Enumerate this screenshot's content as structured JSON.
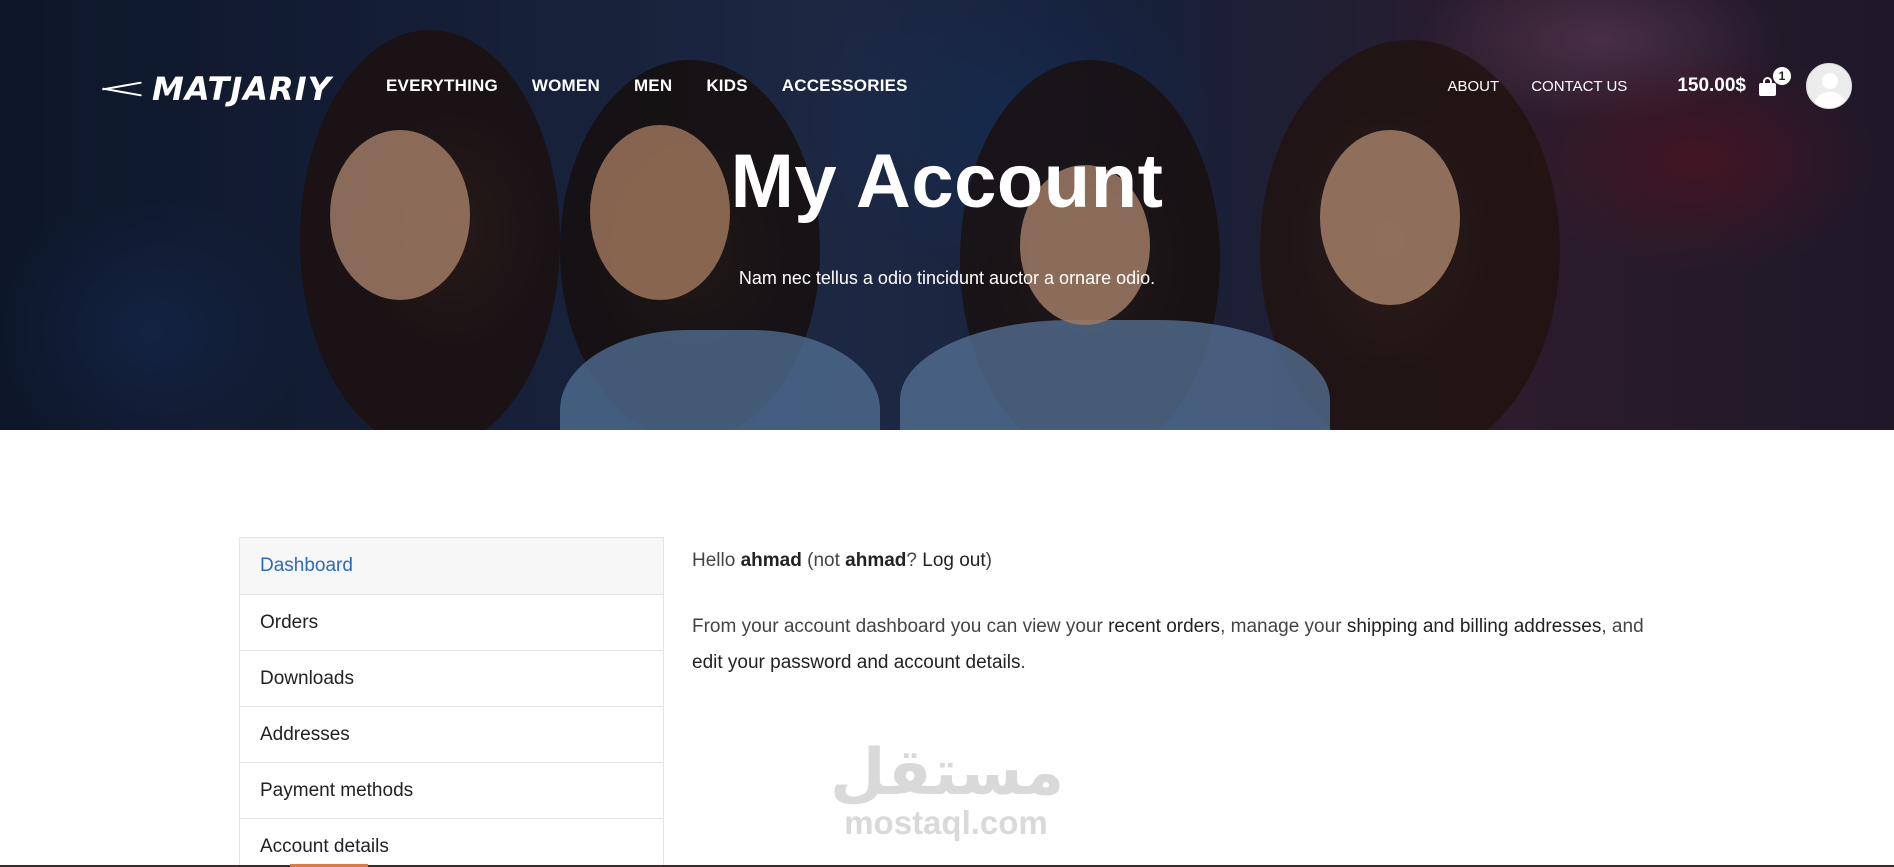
{
  "header": {
    "logo_text": "MATJARIY",
    "nav": [
      "EVERYTHING",
      "WOMEN",
      "MEN",
      "KIDS",
      "ACCESSORIES"
    ],
    "right_links": [
      "ABOUT",
      "CONTACT US"
    ],
    "cart_total": "150.00$",
    "cart_count": "1"
  },
  "hero": {
    "title": "My Account",
    "subtitle": "Nam nec tellus a odio tincidunt auctor a ornare odio."
  },
  "account_nav": {
    "items": [
      "Dashboard",
      "Orders",
      "Downloads",
      "Addresses",
      "Payment methods",
      "Account details"
    ],
    "active": "Dashboard"
  },
  "content": {
    "hello": "Hello",
    "username": "ahmad",
    "not_text": "(not",
    "username_2": "ahmad",
    "question": "?",
    "logout": "Log out",
    "close_paren": ")",
    "intro": "From your account dashboard you can view your",
    "recent_orders": "recent orders",
    "manage": ", manage your",
    "addresses": "shipping and billing addresses",
    "and": ", and",
    "edit": "edit your password and account details",
    "end": "."
  },
  "watermark": {
    "arabic": "مستقل",
    "latin": "mostaql.com"
  },
  "colors": {
    "active_link": "#2a6bbf",
    "accent_line": "#e07a3c"
  }
}
